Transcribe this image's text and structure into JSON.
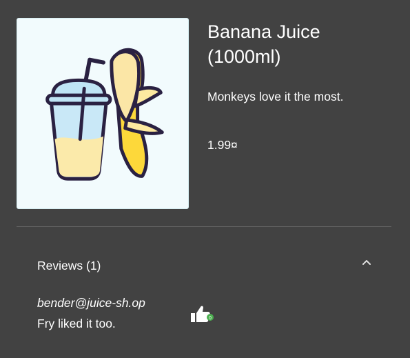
{
  "product": {
    "name": "Banana Juice (1000ml)",
    "description": "Monkeys love it the most.",
    "price": "1.99¤",
    "image_icon": "banana-juice-image"
  },
  "reviews": {
    "title": "Reviews (1)",
    "expanded": true,
    "items": [
      {
        "author": "bender@juice-sh.op",
        "message": "Fry liked it too.",
        "like_icon": "thumbs-up-icon"
      }
    ]
  },
  "colors": {
    "background": "#424242",
    "text": "#ffffff",
    "divider": "#616161",
    "image_background": "#f2fbfd",
    "like_badge": "#4caf50"
  }
}
